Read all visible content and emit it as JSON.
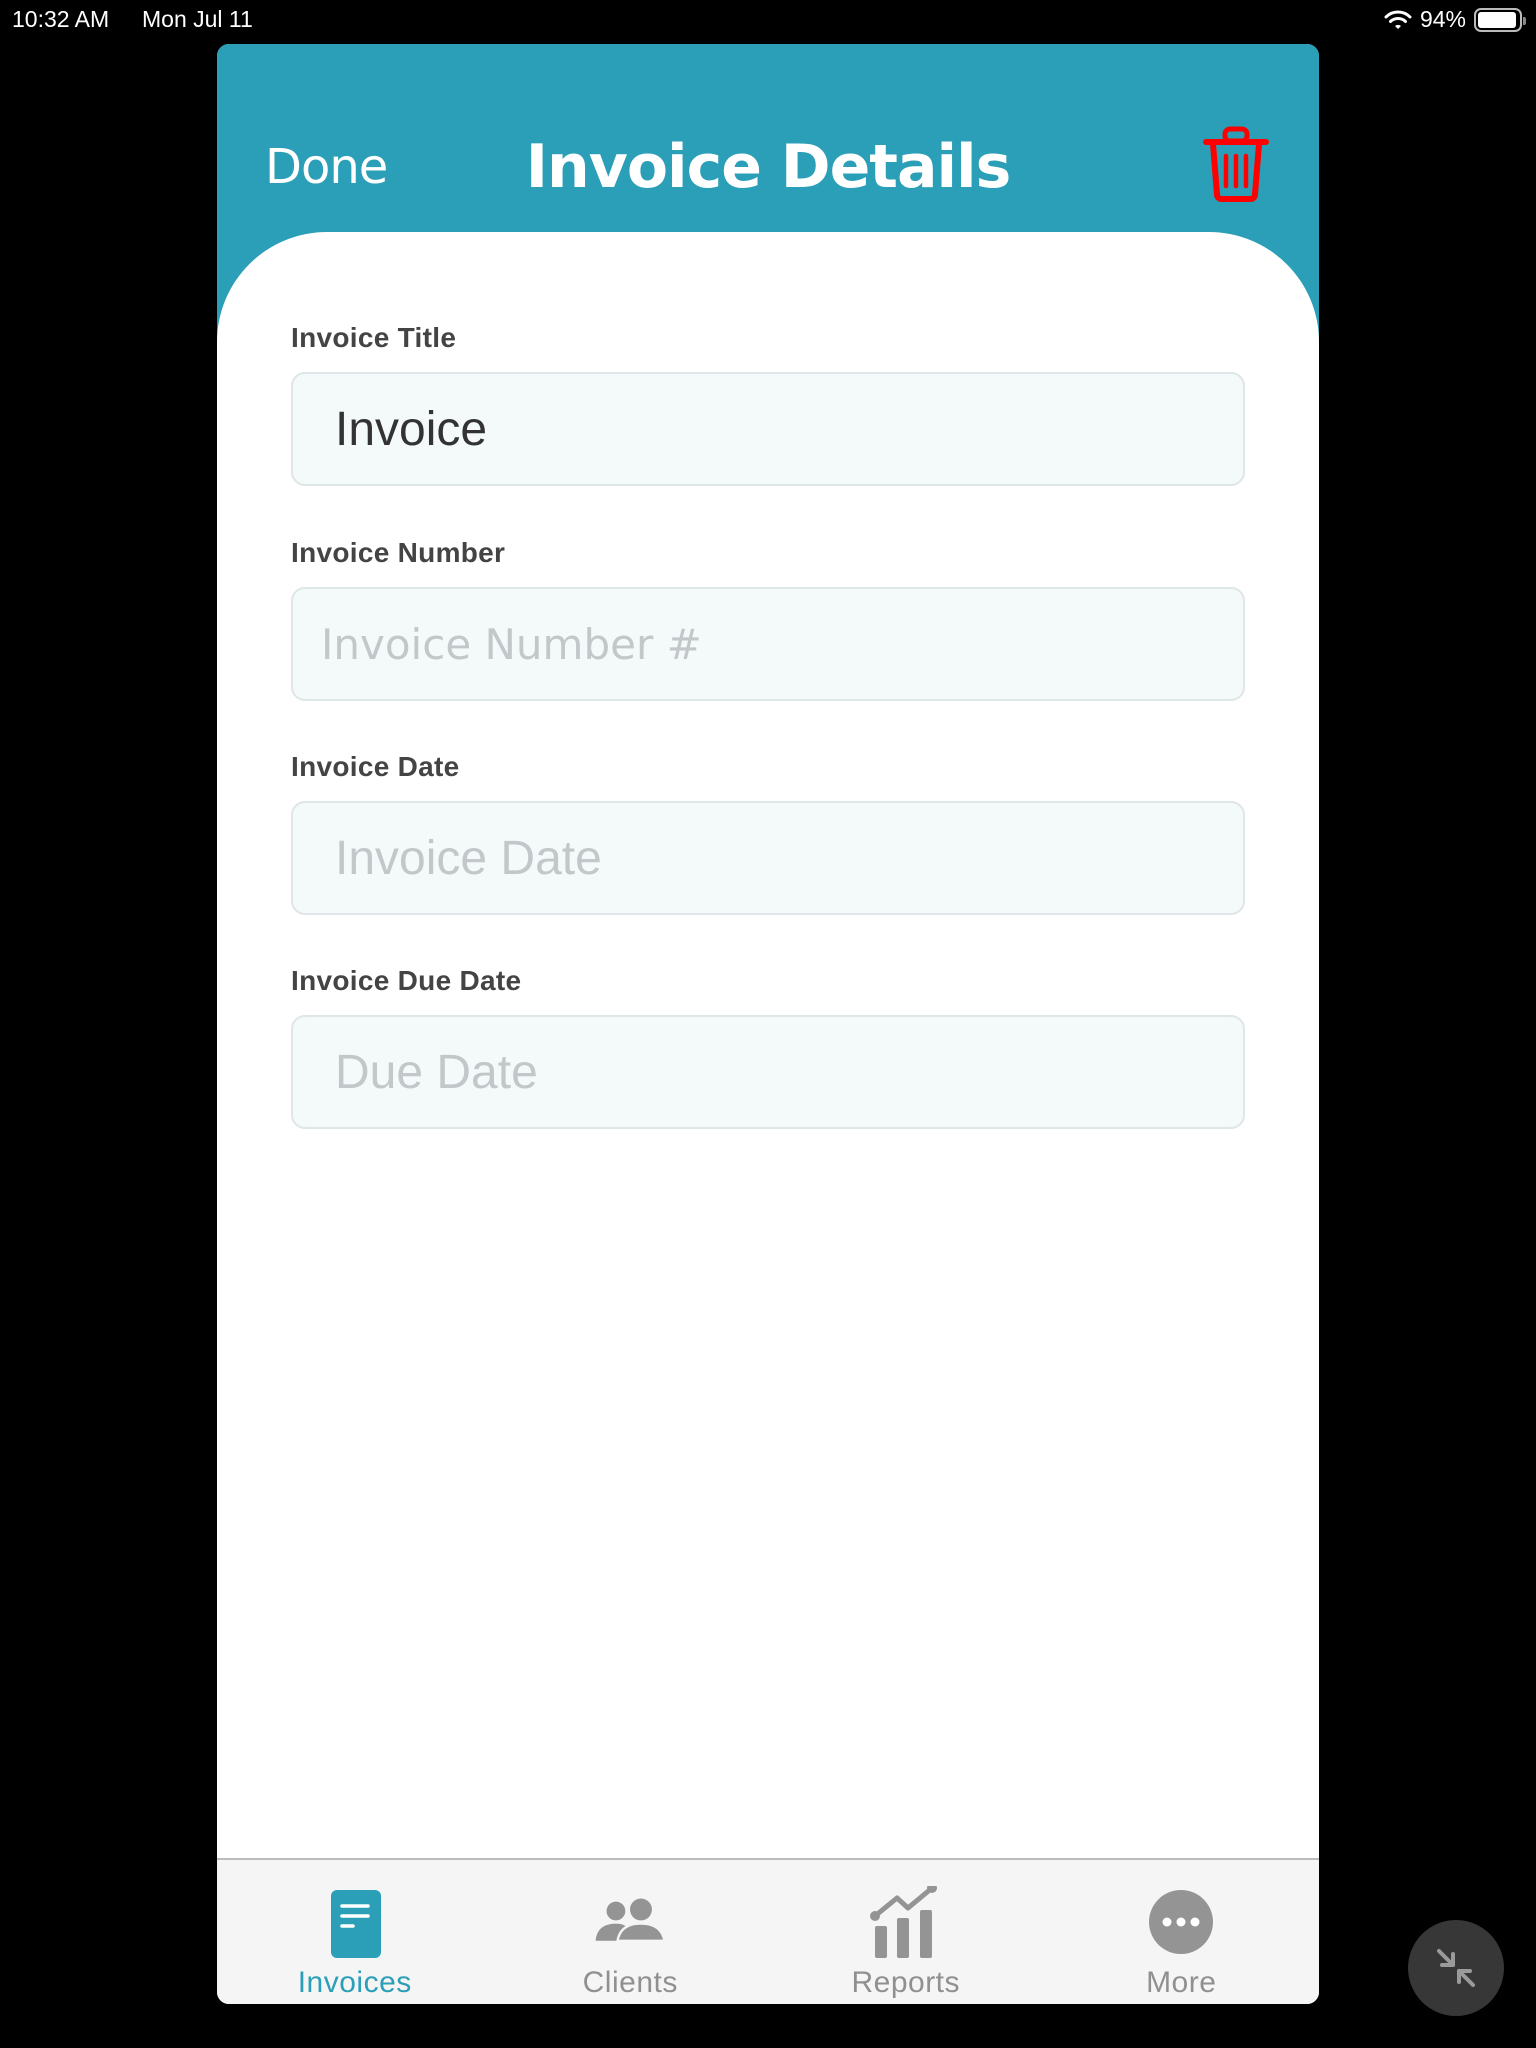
{
  "status_bar": {
    "time": "10:32 AM",
    "date": "Mon Jul 11",
    "battery_percent": "94%",
    "battery_level": 0.94,
    "wifi_icon": "wifi-icon",
    "battery_icon": "battery-icon"
  },
  "header": {
    "done_label": "Done",
    "title": "Invoice Details",
    "delete_icon": "trash-icon",
    "bg_color": "#2b9fb7",
    "delete_color": "#ff0000"
  },
  "form": {
    "fields": [
      {
        "label": "Invoice Title",
        "value": "Invoice",
        "placeholder": ""
      },
      {
        "label": "Invoice Number",
        "value": "",
        "placeholder": "Invoice Number #"
      },
      {
        "label": "Invoice Date",
        "value": "",
        "placeholder": "Invoice Date"
      },
      {
        "label": "Invoice Due Date",
        "value": "",
        "placeholder": "Due Date"
      }
    ]
  },
  "tab_bar": {
    "active_color": "#2b9fb7",
    "inactive_color": "#909090",
    "tabs": [
      {
        "label": "Invoices",
        "icon": "document-icon",
        "active": true
      },
      {
        "label": "Clients",
        "icon": "people-icon",
        "active": false
      },
      {
        "label": "Reports",
        "icon": "chart-icon",
        "active": false
      },
      {
        "label": "More",
        "icon": "more-icon",
        "active": false
      }
    ]
  },
  "floating_button": {
    "icon": "collapse-arrows-icon"
  }
}
